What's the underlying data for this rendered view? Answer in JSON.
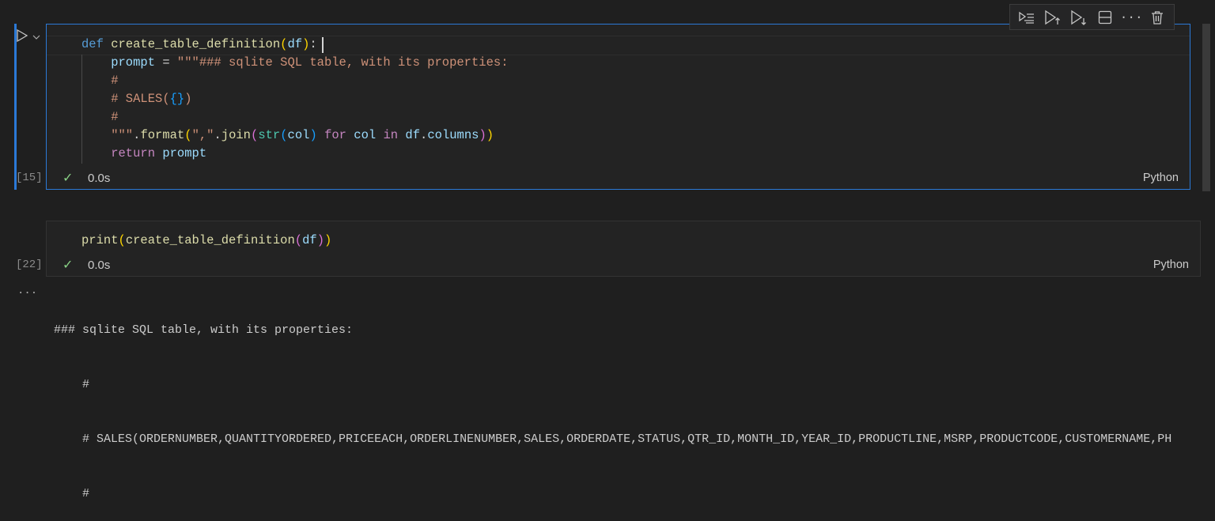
{
  "toolbar": {
    "icons": [
      "run-by-line-icon",
      "execute-above-icon",
      "execute-below-icon",
      "split-cell-icon",
      "more-icon",
      "delete-icon"
    ]
  },
  "cell1": {
    "execution_count": "[15]",
    "status": "0.0s",
    "language": "Python",
    "lines": [
      [
        [
          "kw",
          "def "
        ],
        [
          "fn",
          "create_table_definition"
        ],
        [
          "br",
          "("
        ],
        [
          "var",
          "df"
        ],
        [
          "br",
          ")"
        ],
        [
          "pl",
          ":"
        ]
      ],
      [
        [
          "var",
          "    prompt"
        ],
        [
          "pl",
          " = "
        ],
        [
          "str",
          "\"\"\"### sqlite SQL table, with its properties:"
        ]
      ],
      [
        [
          "str",
          "    #"
        ]
      ],
      [
        [
          "str",
          "    # SALES("
        ],
        [
          "br3",
          "{}"
        ],
        [
          "str",
          ")"
        ]
      ],
      [
        [
          "str",
          "    #"
        ]
      ],
      [
        [
          "str",
          "    \"\"\""
        ],
        [
          "pl",
          "."
        ],
        [
          "fn",
          "format"
        ],
        [
          "br",
          "("
        ],
        [
          "str",
          "\",\""
        ],
        [
          "pl",
          "."
        ],
        [
          "fn",
          "join"
        ],
        [
          "br2",
          "("
        ],
        [
          "bi",
          "str"
        ],
        [
          "br3",
          "("
        ],
        [
          "var",
          "col"
        ],
        [
          "br3",
          ")"
        ],
        [
          "pl",
          " "
        ],
        [
          "ctl",
          "for"
        ],
        [
          "pl",
          " "
        ],
        [
          "var",
          "col"
        ],
        [
          "pl",
          " "
        ],
        [
          "ctl",
          "in"
        ],
        [
          "pl",
          " "
        ],
        [
          "var",
          "df"
        ],
        [
          "pl",
          "."
        ],
        [
          "var",
          "columns"
        ],
        [
          "br2",
          ")"
        ],
        [
          "br",
          ")"
        ]
      ],
      [
        [
          "ctl",
          "    return"
        ],
        [
          "pl",
          " "
        ],
        [
          "var",
          "prompt"
        ]
      ]
    ]
  },
  "cell2": {
    "execution_count": "[22]",
    "status": "0.0s",
    "language": "Python",
    "lines": [
      [
        [
          "fn",
          "print"
        ],
        [
          "br",
          "("
        ],
        [
          "fn",
          "create_table_definition"
        ],
        [
          "br2",
          "("
        ],
        [
          "var",
          "df"
        ],
        [
          "br2",
          ")"
        ],
        [
          "br",
          ")"
        ]
      ]
    ],
    "output_marker": "...",
    "output": [
      "### sqlite SQL table, with its properties:",
      "    #",
      "    # SALES(ORDERNUMBER,QUANTITYORDERED,PRICEEACH,ORDERLINENUMBER,SALES,ORDERDATE,STATUS,QTR_ID,MONTH_ID,YEAR_ID,PRODUCTLINE,MSRP,PRODUCTCODE,CUSTOMERNAME,PH",
      "    #"
    ]
  }
}
